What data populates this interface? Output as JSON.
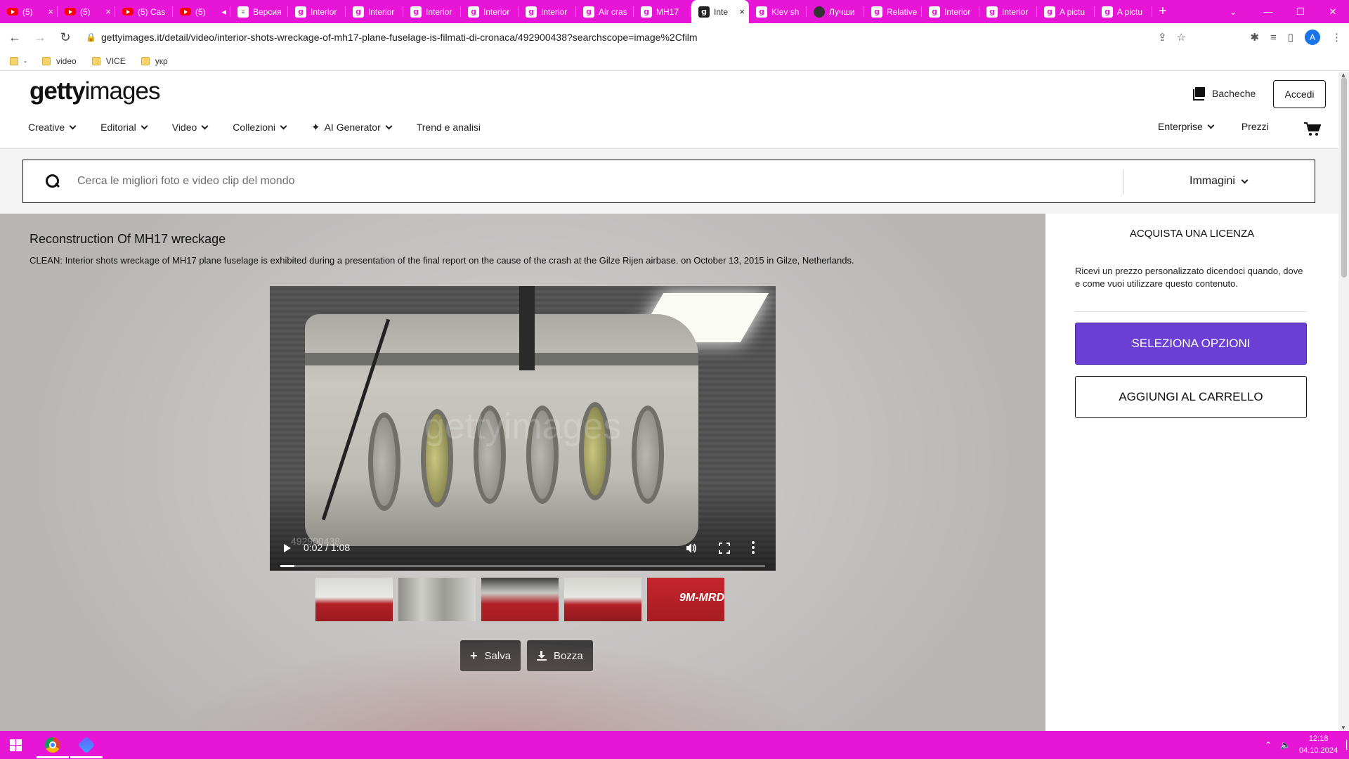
{
  "browser": {
    "tabs": [
      {
        "icon": "youtube-icon",
        "title": "(5)",
        "close": "×"
      },
      {
        "icon": "youtube-icon",
        "title": "(5)",
        "close": "×"
      },
      {
        "icon": "youtube-icon",
        "title": "(5) Cas",
        "close": ""
      },
      {
        "icon": "youtube-icon",
        "title": "(5)",
        "close": "◂"
      },
      {
        "icon": "doc-icon",
        "title": "Версия",
        "close": ""
      },
      {
        "icon": "gettyimages-icon",
        "title": "Interior",
        "close": ""
      },
      {
        "icon": "gettyimages-icon",
        "title": "Interior",
        "close": ""
      },
      {
        "icon": "gettyimages-icon",
        "title": "Interior",
        "close": ""
      },
      {
        "icon": "gettyimages-icon",
        "title": "Interior",
        "close": ""
      },
      {
        "icon": "gettyimages-icon",
        "title": "Interior",
        "close": ""
      },
      {
        "icon": "gettyimages-icon",
        "title": "Air cras",
        "close": ""
      },
      {
        "icon": "gettyimages-icon",
        "title": "MH17",
        "close": ""
      },
      {
        "icon": "gettyimages-icon",
        "title": "Inte",
        "close": "×",
        "active": true
      },
      {
        "icon": "gettyimages-icon",
        "title": "Kiev sh",
        "close": ""
      },
      {
        "icon": "site-icon",
        "title": "Лучши",
        "close": ""
      },
      {
        "icon": "gettyimages-icon",
        "title": "Relative",
        "close": ""
      },
      {
        "icon": "gettyimages-icon",
        "title": "Interior",
        "close": ""
      },
      {
        "icon": "gettyimages-icon",
        "title": "Interior",
        "close": ""
      },
      {
        "icon": "gettyimages-icon",
        "title": "A pictu",
        "close": ""
      },
      {
        "icon": "gettyimages-icon",
        "title": "A pictu",
        "close": ""
      }
    ],
    "new_tab": "+",
    "url": "gettyimages.it/detail/video/interior-shots-wreckage-of-mh17-plane-fuselage-is-filmati-di-cronaca/492900438?searchscope=image%2Cfilm",
    "profile_initial": "A",
    "bookmarks": [
      "-",
      "video",
      "VICE",
      "укр"
    ]
  },
  "header": {
    "logo_bold": "getty",
    "logo_regular": "images",
    "boards_label": "Bacheche",
    "signin_label": "Accedi",
    "nav": [
      "Creative",
      "Editorial",
      "Video",
      "Collezioni",
      "AI Generator",
      "Trend e analisi"
    ],
    "nav_right": [
      "Enterprise",
      "Prezzi"
    ]
  },
  "search": {
    "placeholder": "Cerca le migliori foto e video clip del mondo",
    "type_label": "Immagini"
  },
  "video": {
    "title": "Reconstruction Of MH17 wreckage",
    "caption": "CLEAN: Interior shots wreckage of MH17 plane fuselage is exhibited during a presentation of the final report on the cause of the crash at the Gilze Rijen airbase. on October 13, 2015 in Gilze, Netherlands.",
    "watermark": "gettyimages",
    "asset_id": "492900438",
    "time": "0:02 / 1:08",
    "progress_fraction": 0.029,
    "thumbnail_label": "9M-MRD",
    "save_label": "Salva",
    "draft_label": "Bozza"
  },
  "license": {
    "title": "ACQUISTA UNA LICENZA",
    "description": "Ricevi un prezzo personalizzato dicendoci quando, dove e come vuoi utilizzare questo contenuto.",
    "primary_button": "SELEZIONA OPZIONI",
    "secondary_button": "AGGIUNGI AL CARRELLO",
    "accent_color": "#6b3fd4"
  },
  "taskbar": {
    "time": "12:18",
    "date": "04.10.2024"
  },
  "colors": {
    "chrome_accent": "#e716d6"
  }
}
